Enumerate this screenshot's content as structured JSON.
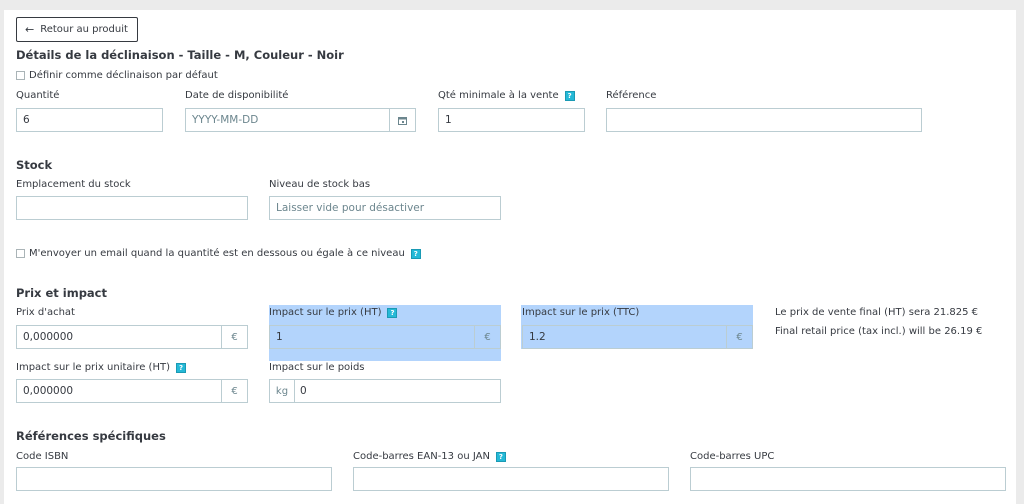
{
  "back_button": {
    "label": "Retour au produit"
  },
  "title": "Détails de la déclinaison - Taille - M, Couleur - Noir",
  "default_checkbox": "Définir comme déclinaison par défaut",
  "fields": {
    "quantity": {
      "label": "Quantité",
      "value": "6"
    },
    "availability_date": {
      "label": "Date de disponibilité",
      "placeholder": "YYYY-MM-DD"
    },
    "min_qty": {
      "label": "Qté minimale à la vente",
      "value": "1"
    },
    "reference": {
      "label": "Référence",
      "value": ""
    }
  },
  "stock": {
    "heading": "Stock",
    "location": {
      "label": "Emplacement du stock",
      "value": ""
    },
    "low_level": {
      "label": "Niveau de stock bas",
      "placeholder": "Laisser vide pour désactiver"
    },
    "email_checkbox": "M'envoyer un email quand la quantité est en dessous ou égale à ce niveau"
  },
  "price": {
    "heading": "Prix et impact",
    "purchase": {
      "label": "Prix d'achat",
      "value": "0,000000",
      "unit": "€"
    },
    "impact_ht": {
      "label": "Impact sur le prix (HT)",
      "value": "1",
      "unit": "€"
    },
    "impact_ttc": {
      "label": "Impact sur le prix (TTC)",
      "value": "1.2",
      "unit": "€"
    },
    "final_ht_text": "Le prix de vente final (HT) sera 21.825 €",
    "final_ttc_text": "Final retail price (tax incl.) will be 26.19 €",
    "unit_price": {
      "label": "Impact sur le prix unitaire (HT)",
      "value": "0,000000",
      "unit": "€"
    },
    "weight": {
      "label": "Impact sur le poids",
      "value": "0",
      "unit": "kg"
    }
  },
  "refs": {
    "heading": "Références spécifiques",
    "isbn": {
      "label": "Code ISBN",
      "value": ""
    },
    "ean": {
      "label": "Code-barres EAN-13 ou JAN",
      "value": ""
    },
    "upc": {
      "label": "Code-barres UPC",
      "value": ""
    }
  },
  "help_glyph": "?",
  "colors": {
    "accent": "#25b9d7",
    "border": "#bbcdd2",
    "selection": "#b3d4fc",
    "text": "#363a41"
  }
}
